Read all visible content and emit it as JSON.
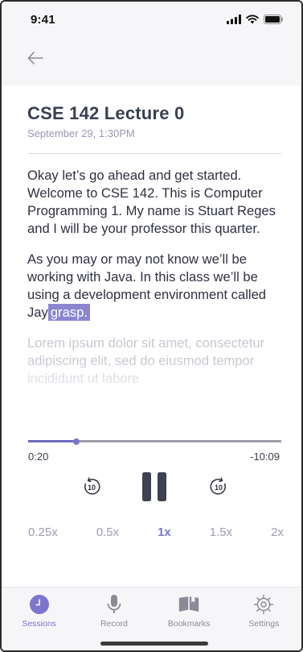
{
  "status_bar": {
    "time": "9:41"
  },
  "lecture": {
    "title": "CSE 142 Lecture 0",
    "date": "September 29, 1:30PM"
  },
  "transcript": {
    "paragraph1": "Okay let’s go ahead and get started. Welcome to CSE 142. This is Computer Programming 1. My name is Stuart Reges and I will be your professor this quarter.",
    "paragraph2": "As you may or may not know we’ll be working with Java. In this class we’ll be using a development environment called Jay",
    "highlighted_word": "grasp.",
    "paragraph3": "Lorem ipsum dolor sit amet, consectetur adipiscing elit, sed do eiusmod tempor incididunt ut labore"
  },
  "player": {
    "elapsed": "0:20",
    "remaining": "-10:09",
    "progress_fraction": 0.19,
    "skip_back_seconds": "10",
    "skip_forward_seconds": "10"
  },
  "speeds": {
    "options": [
      "0.25x",
      "0.5x",
      "1x",
      "1.5x",
      "2x"
    ],
    "selected": "1x"
  },
  "tabs": [
    {
      "label": "Sessions",
      "icon": "clock-icon",
      "active": true
    },
    {
      "label": "Record",
      "icon": "microphone-icon",
      "active": false
    },
    {
      "label": "Bookmarks",
      "icon": "bookmarks-icon",
      "active": false
    },
    {
      "label": "Settings",
      "icon": "gear-icon",
      "active": false
    }
  ],
  "colors": {
    "accent": "#7b75cf",
    "highlight": "#8a86d0",
    "title": "#3a3e51",
    "muted": "#9e9cb6"
  }
}
